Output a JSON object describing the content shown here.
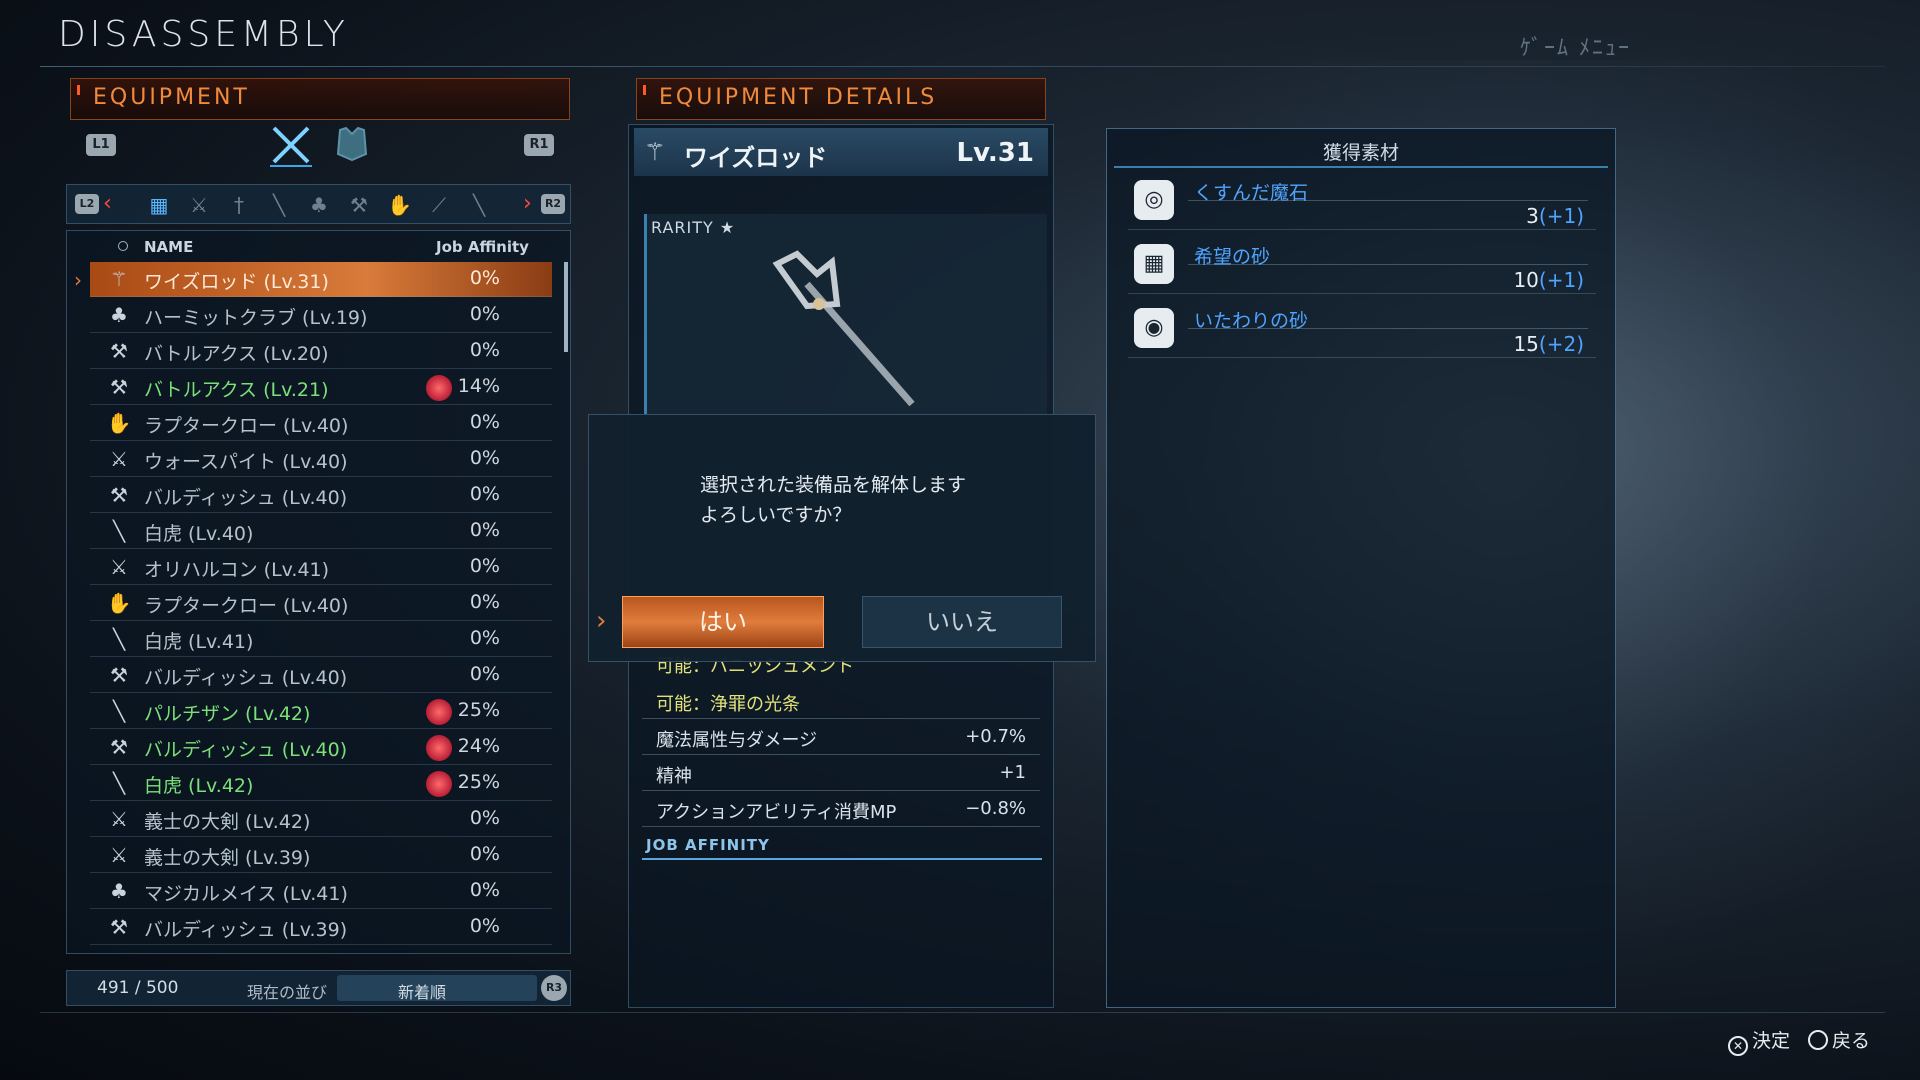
{
  "screen_title": "DISASSEMBLY",
  "top_right_label": "ｹﾞｰﾑ ﾒﾆｭｰ",
  "equipment": {
    "header": "EQUIPMENT",
    "l1": "L1",
    "r1": "R1",
    "l2": "L2",
    "r2": "R2",
    "col_name": "NAME",
    "col_affinity": "Job Affinity",
    "items": [
      {
        "name": "ワイズロッド (Lv.31)",
        "pct": "0%",
        "icon": "rod-icon",
        "green": false,
        "selected": true,
        "job": false
      },
      {
        "name": "ハーミットクラブ (Lv.19)",
        "pct": "0%",
        "icon": "mace-icon",
        "green": false,
        "selected": false,
        "job": false
      },
      {
        "name": "バトルアクス (Lv.20)",
        "pct": "0%",
        "icon": "axe-icon",
        "green": false,
        "selected": false,
        "job": false
      },
      {
        "name": "バトルアクス (Lv.21)",
        "pct": "14%",
        "icon": "axe-icon",
        "green": true,
        "selected": false,
        "job": true
      },
      {
        "name": "ラプタークロー (Lv.40)",
        "pct": "0%",
        "icon": "claw-icon",
        "green": false,
        "selected": false,
        "job": false
      },
      {
        "name": "ウォースパイト (Lv.40)",
        "pct": "0%",
        "icon": "sword-icon",
        "green": false,
        "selected": false,
        "job": false
      },
      {
        "name": "バルディッシュ (Lv.40)",
        "pct": "0%",
        "icon": "axe-icon",
        "green": false,
        "selected": false,
        "job": false
      },
      {
        "name": "白虎 (Lv.40)",
        "pct": "0%",
        "icon": "spear-icon",
        "green": false,
        "selected": false,
        "job": false
      },
      {
        "name": "オリハルコン (Lv.41)",
        "pct": "0%",
        "icon": "sword-icon",
        "green": false,
        "selected": false,
        "job": false
      },
      {
        "name": "ラプタークロー (Lv.40)",
        "pct": "0%",
        "icon": "claw-icon",
        "green": false,
        "selected": false,
        "job": false
      },
      {
        "name": "白虎 (Lv.41)",
        "pct": "0%",
        "icon": "spear-icon",
        "green": false,
        "selected": false,
        "job": false
      },
      {
        "name": "バルディッシュ (Lv.40)",
        "pct": "0%",
        "icon": "axe-icon",
        "green": false,
        "selected": false,
        "job": false
      },
      {
        "name": "パルチザン (Lv.42)",
        "pct": "25%",
        "icon": "spear-icon",
        "green": true,
        "selected": false,
        "job": true
      },
      {
        "name": "バルディッシュ (Lv.40)",
        "pct": "24%",
        "icon": "axe-icon",
        "green": true,
        "selected": false,
        "job": true
      },
      {
        "name": "白虎 (Lv.42)",
        "pct": "25%",
        "icon": "spear-icon",
        "green": true,
        "selected": false,
        "job": true
      },
      {
        "name": "義士の大剣 (Lv.42)",
        "pct": "0%",
        "icon": "sword-icon",
        "green": false,
        "selected": false,
        "job": false
      },
      {
        "name": "義士の大剣 (Lv.39)",
        "pct": "0%",
        "icon": "sword-icon",
        "green": false,
        "selected": false,
        "job": false
      },
      {
        "name": "マジカルメイス (Lv.41)",
        "pct": "0%",
        "icon": "mace-icon",
        "green": false,
        "selected": false,
        "job": false
      },
      {
        "name": "バルディッシュ (Lv.39)",
        "pct": "0%",
        "icon": "axe-icon",
        "green": false,
        "selected": false,
        "job": false
      }
    ],
    "count": "491 / 500",
    "sort_label": "現在の並び",
    "sort_value": "新着順",
    "r3": "R3"
  },
  "details": {
    "header": "EQUIPMENT DETAILS",
    "item_name": "ワイズロッド",
    "item_level": "Lv.31",
    "rarity": "RARITY ★",
    "partial_line": "可能：バニッシュメント",
    "ability": "可能：浄罪の光条",
    "stats": [
      {
        "label": "魔法属性与ダメージ",
        "value": "+0.7%"
      },
      {
        "label": "精神",
        "value": "+1"
      },
      {
        "label": "アクションアビリティ消費MP",
        "value": "−0.8%"
      }
    ],
    "job_affinity": "JOB AFFINITY"
  },
  "materials": {
    "header": "獲得素材",
    "items": [
      {
        "name": "くすんだ魔石",
        "qty": "3",
        "plus": "(+1)"
      },
      {
        "name": "希望の砂",
        "qty": "10",
        "plus": "(+1)"
      },
      {
        "name": "いたわりの砂",
        "qty": "15",
        "plus": "(+2)"
      }
    ]
  },
  "dialog": {
    "line1": "選択された装備品を解体します",
    "line2": "よろしいですか？",
    "yes": "はい",
    "no": "いいえ"
  },
  "hints": {
    "confirm": "決定",
    "back": "戻る"
  },
  "colors": {
    "accent_orange": "#e07c3c",
    "green_text": "#7be07a",
    "material_blue": "#4fa4ff"
  }
}
